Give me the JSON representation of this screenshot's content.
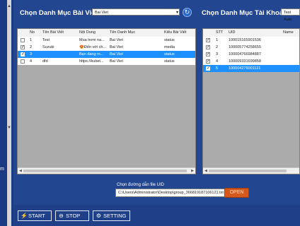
{
  "left_panel": {
    "title": "Chọn Danh Mục Bài Viết",
    "category_select": "Bai Viet",
    "columns": [
      "No",
      "Tên Bài Viết",
      "Nội Dung",
      "Tên Danh Mục",
      "Kiểu Bài Viết"
    ],
    "rows": [
      {
        "checked": false,
        "no": "1",
        "title": "Test",
        "content": "Mua hơm na...",
        "category": "Bai Viet",
        "type": "status",
        "selected": false
      },
      {
        "checked": true,
        "no": "2",
        "title": "Suzuki",
        "content": "😍Đến với ch...",
        "category": "Bai Viet",
        "type": "media",
        "selected": false
      },
      {
        "checked": true,
        "no": "3",
        "title": "",
        "content": "Bạn đang m...",
        "category": "Bai Viet",
        "type": "status",
        "selected": true
      },
      {
        "checked": false,
        "no": "4",
        "title": "dfd",
        "content": "https://kubet...",
        "category": "Bai Viet",
        "type": "status",
        "selected": false
      }
    ]
  },
  "right_panel": {
    "title": "Chọn Danh Mục Tài Khoản",
    "category_select": "Test Auto",
    "columns": [
      "STT",
      "UID",
      "Name"
    ],
    "rows": [
      {
        "checked": true,
        "stt": "1",
        "uid": "100015165901536",
        "name": "",
        "selected": false
      },
      {
        "checked": true,
        "stt": "2",
        "uid": "100005774258655",
        "name": "",
        "selected": false
      },
      {
        "checked": true,
        "stt": "3",
        "uid": "100004766984887",
        "name": "",
        "selected": false
      },
      {
        "checked": true,
        "stt": "4",
        "uid": "100009331699858",
        "name": "",
        "selected": false
      },
      {
        "checked": true,
        "stt": "5",
        "uid": "100004276001121",
        "name": "",
        "selected": true
      }
    ]
  },
  "uid_file": {
    "label": "Chọn đường dẫn file UID",
    "path": "C:\\Users\\Administrator\\Desktop\\group_366819187106121.txt",
    "open_label": "OPEN"
  },
  "toolbar": {
    "start_label": "START",
    "stop_label": "STOP",
    "setting_label": "SETTING"
  },
  "side_strip": {
    "label": "m"
  },
  "colors": {
    "background": "#22468f",
    "selection": "#1e90ff",
    "open_button": "#d35a1c"
  },
  "icons": {
    "refresh": "refresh-icon",
    "start": "lightning-icon",
    "stop": "stop-icon",
    "setting": "gear-icon"
  }
}
